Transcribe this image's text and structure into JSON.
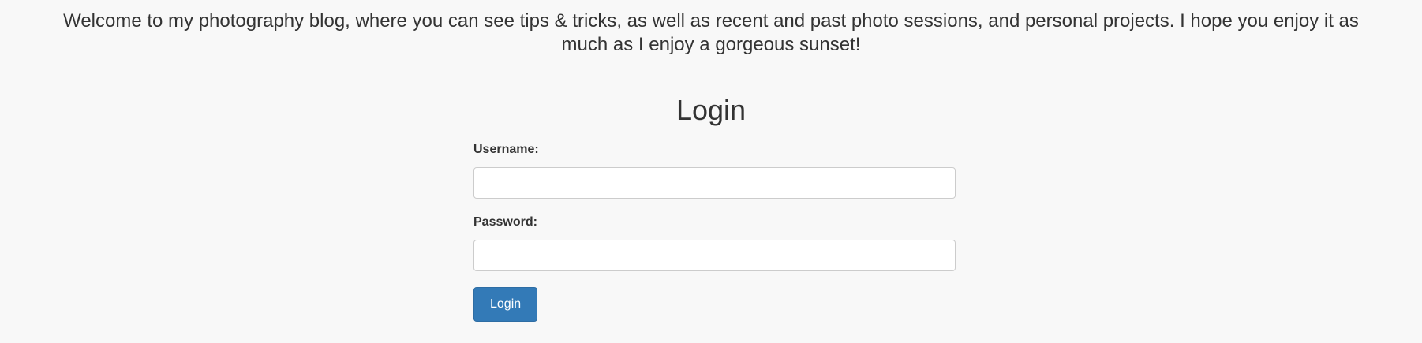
{
  "intro": {
    "text": "Welcome to my photography blog, where you can see tips & tricks, as well as recent and past photo sessions, and personal projects. I hope you enjoy it as much as I enjoy a gorgeous sunset!"
  },
  "login": {
    "title": "Login",
    "username_label": "Username:",
    "username_value": "",
    "password_label": "Password:",
    "password_value": "",
    "submit_label": "Login"
  },
  "colors": {
    "background": "#f8f8f8",
    "text": "#333333",
    "button_bg": "#337ab7",
    "button_text": "#ffffff",
    "input_border": "#cccccc"
  }
}
